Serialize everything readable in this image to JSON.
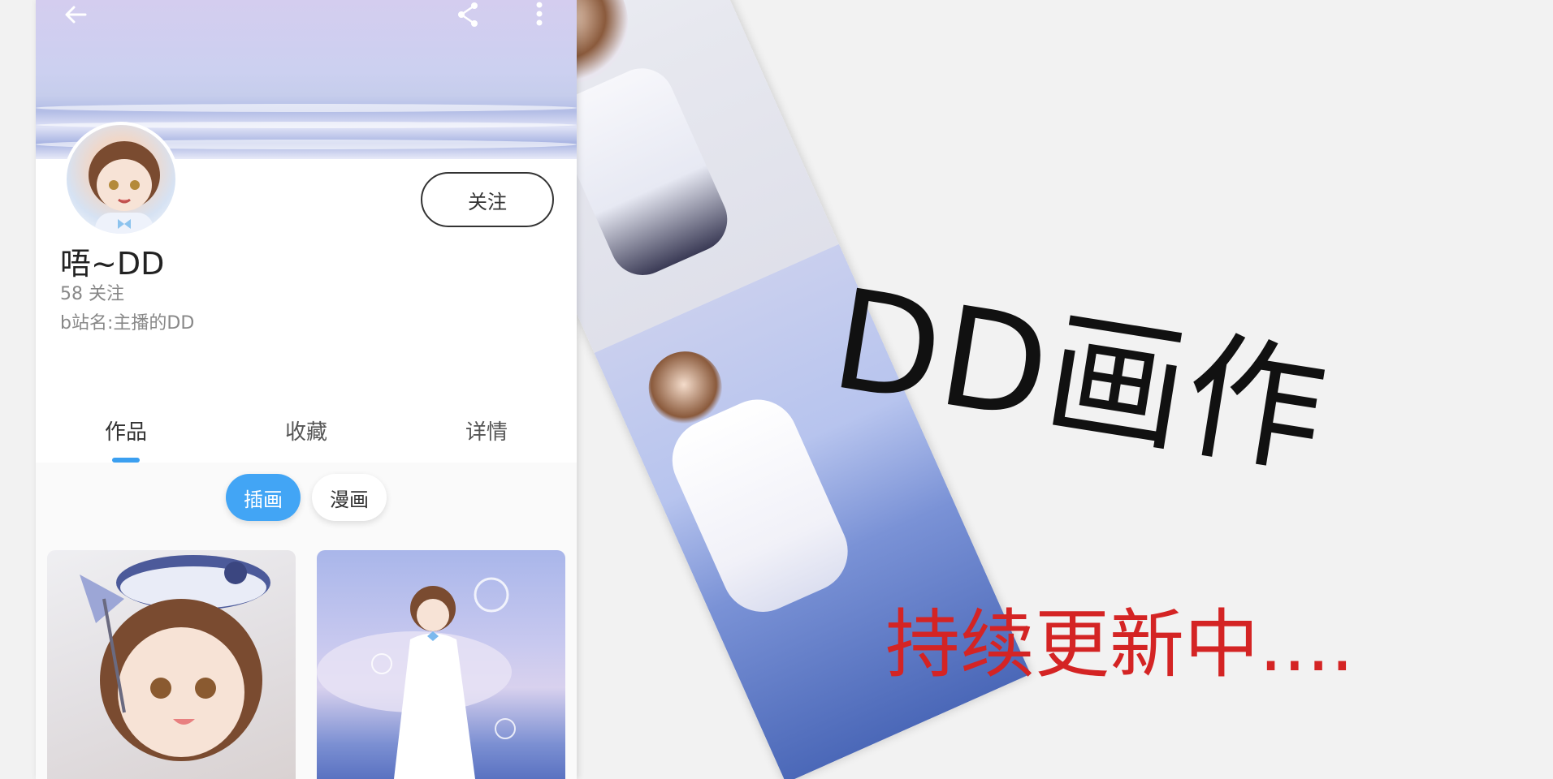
{
  "profile": {
    "username": "唔~DD",
    "follow_count": "58 关注",
    "bio": "b站名:主播的DD",
    "follow_label": "关注"
  },
  "tabs": [
    {
      "label": "作品",
      "active": true
    },
    {
      "label": "收藏",
      "active": false
    },
    {
      "label": "详情",
      "active": false
    }
  ],
  "filters": [
    {
      "label": "插画",
      "active": true
    },
    {
      "label": "漫画",
      "active": false
    }
  ],
  "icons": {
    "back": "back-arrow-icon",
    "share": "share-icon",
    "more": "more-vertical-icon"
  },
  "colors": {
    "accent": "#42a5f5",
    "subtitle": "#d42424"
  },
  "promo": {
    "title": "DD画作",
    "subtitle": "持续更新中...."
  }
}
